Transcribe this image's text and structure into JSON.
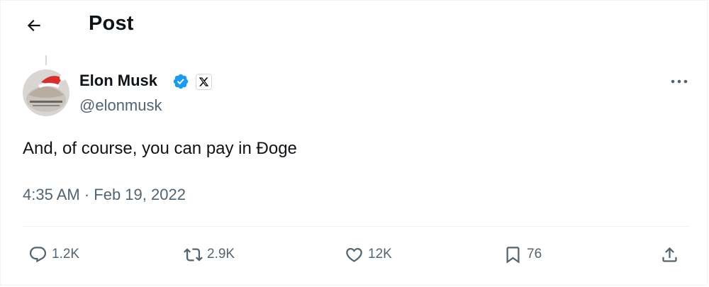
{
  "header": {
    "title": "Post",
    "back_icon": "arrow-left-icon"
  },
  "author": {
    "name": "Elon Musk",
    "handle": "@elonmusk",
    "verified_icon": "verified-badge-icon",
    "verified_color": "#1d9bf0",
    "affiliate_icon": "x-logo-icon"
  },
  "post": {
    "text": "And, of course, you can pay in Ðoge",
    "meta": "4:35 AM · Feb 19, 2022"
  },
  "actions": {
    "reply": {
      "icon": "reply-icon",
      "count": "1.2K"
    },
    "repost": {
      "icon": "repost-icon",
      "count": "2.9K"
    },
    "like": {
      "icon": "heart-icon",
      "count": "12K"
    },
    "bookmark": {
      "icon": "bookmark-icon",
      "count": "76"
    },
    "share": {
      "icon": "share-icon"
    }
  },
  "more_icon": "more-horizontal-icon"
}
